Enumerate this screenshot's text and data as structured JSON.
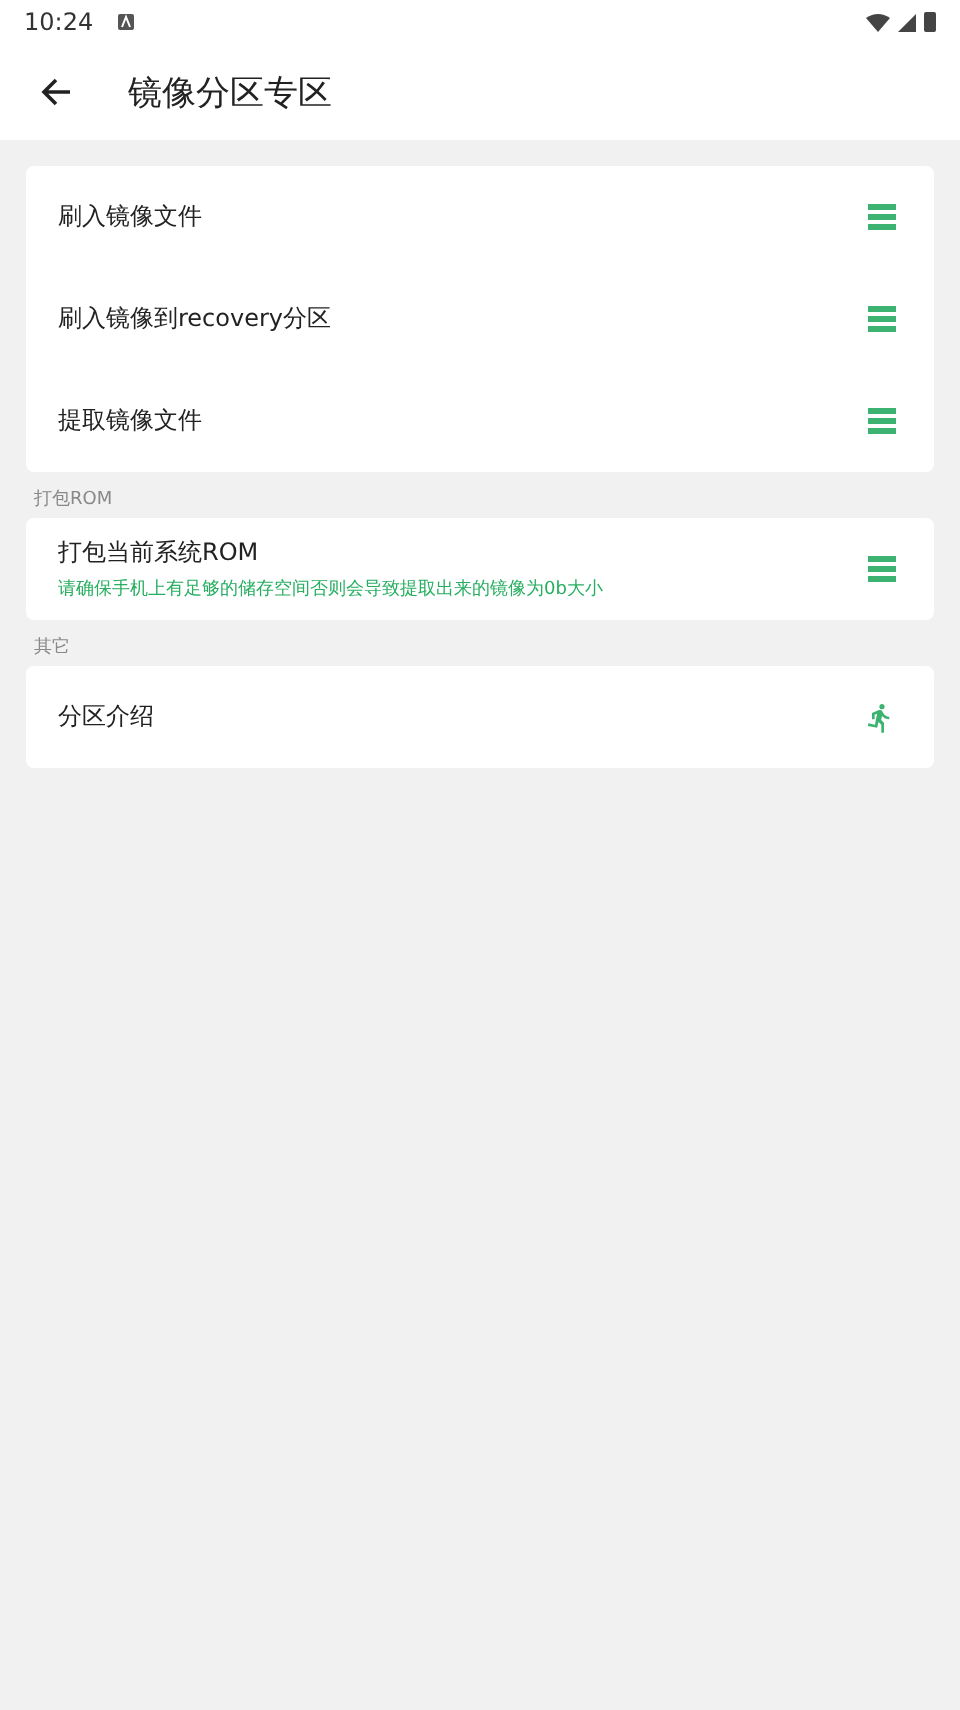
{
  "status_bar": {
    "time": "10:24"
  },
  "toolbar": {
    "title": "镜像分区专区"
  },
  "sections": [
    {
      "items": [
        {
          "label": "刷入镜像文件",
          "kind": "menu"
        },
        {
          "label": "刷入镜像到recovery分区",
          "kind": "menu"
        },
        {
          "label": "提取镜像文件",
          "kind": "menu"
        }
      ]
    },
    {
      "title": "打包ROM",
      "items": [
        {
          "label": "打包当前系统ROM",
          "subtitle": "请确保手机上有足够的储存空间否则会导致提取出来的镜像为0b大小",
          "kind": "menu"
        }
      ]
    },
    {
      "title": "其它",
      "items": [
        {
          "label": "分区介绍",
          "kind": "run"
        }
      ]
    }
  ]
}
